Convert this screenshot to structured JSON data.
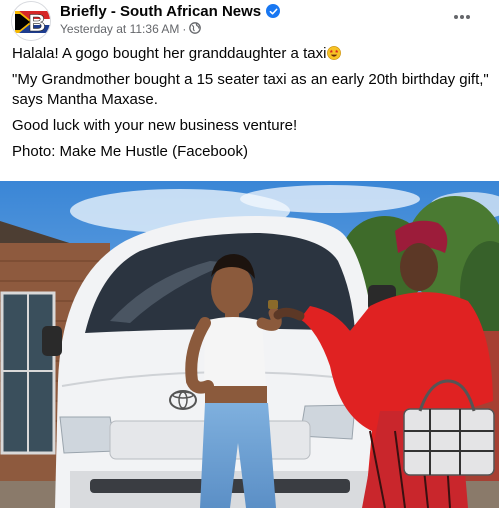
{
  "post": {
    "page_name": "Briefly - South African News",
    "timestamp": "Yesterday at 11:36 AM",
    "separator": "·",
    "icons": {
      "avatar": "briefly-logo",
      "verified": "verified-badge-icon",
      "audience": "globe-icon",
      "more": "more-options-icon",
      "emoji": "star-struck-emoji-icon"
    },
    "colors": {
      "verified": "#1877f2",
      "meta": "#65676b",
      "text": "#050505"
    },
    "paragraphs": {
      "p1": "Halala! A gogo bought her granddaughter a taxi",
      "p2": "\"My Grandmother bought a 15 seater taxi as an early 20th birthday gift,\" says Mantha Maxase.",
      "p3": "Good luck with your new business venture!",
      "p4": "Photo: Make Me Hustle (Facebook)"
    }
  },
  "photo": {
    "vehicle_logo": "toyota-logo"
  }
}
